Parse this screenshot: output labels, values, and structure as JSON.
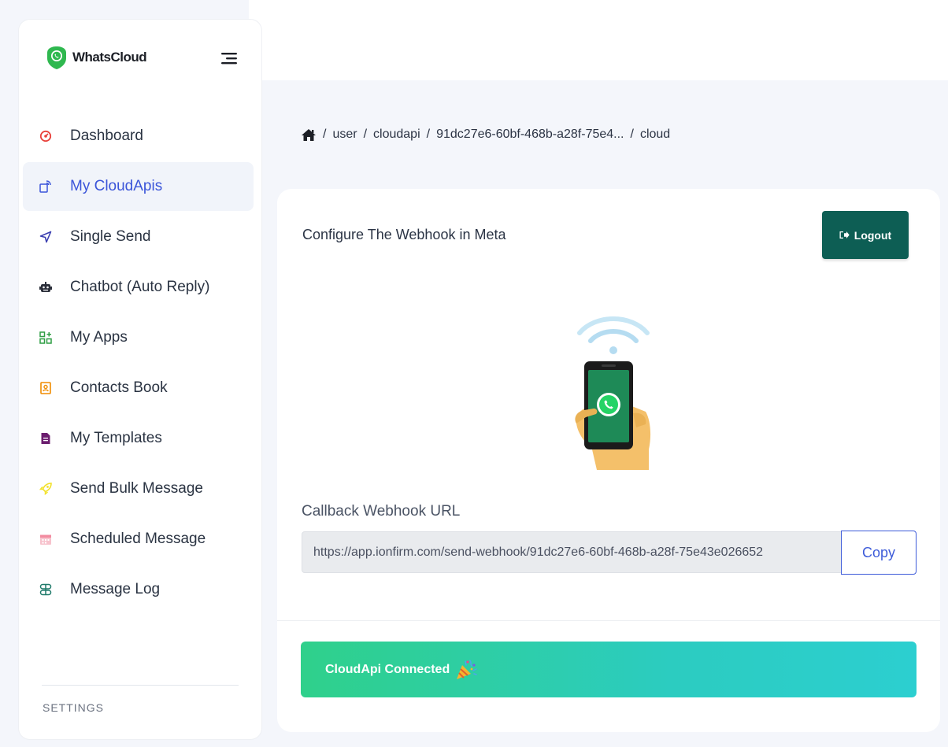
{
  "app": {
    "name": "WhatsCloud"
  },
  "sidebar": {
    "items": [
      {
        "label": "Dashboard",
        "icon": "gauge-icon",
        "color": "#e8413b",
        "active": false
      },
      {
        "label": "My CloudApis",
        "icon": "cloud-api-icon",
        "color": "#3b55d9",
        "active": true
      },
      {
        "label": "Single Send",
        "icon": "send-icon",
        "color": "#3b3fb0",
        "active": false
      },
      {
        "label": "Chatbot (Auto Reply)",
        "icon": "robot-icon",
        "color": "#2b2f3a",
        "active": false
      },
      {
        "label": "My Apps",
        "icon": "apps-icon",
        "color": "#2f9e44",
        "active": false
      },
      {
        "label": "Contacts Book",
        "icon": "contacts-icon",
        "color": "#f08c00",
        "active": false
      },
      {
        "label": "My Templates",
        "icon": "template-icon",
        "color": "#6b1d6e",
        "active": false
      },
      {
        "label": "Send Bulk Message",
        "icon": "rocket-icon",
        "color": "#f2e12a",
        "active": false
      },
      {
        "label": "Scheduled Message",
        "icon": "calendar-icon",
        "color": "#f28ba0",
        "active": false
      },
      {
        "label": "Message Log",
        "icon": "log-icon",
        "color": "#1f7a6a",
        "active": false
      }
    ],
    "settings_label": "SETTINGS"
  },
  "breadcrumb": {
    "items": [
      "user",
      "cloudapi",
      "91dc27e6-60bf-468b-a28f-75e4...",
      "cloud"
    ]
  },
  "card": {
    "title": "Configure The Webhook in Meta",
    "logout_label": "Logout",
    "field_label": "Callback Webhook URL",
    "webhook_url": "https://app.ionfirm.com/send-webhook/91dc27e6-60bf-468b-a28f-75e43e026652",
    "copy_label": "Copy",
    "status_text": "CloudApi Connected"
  },
  "colors": {
    "accent": "#3b55d9",
    "logout_bg": "#0d5e54",
    "success_start": "#2fd08b",
    "success_end": "#2ccfd0"
  }
}
